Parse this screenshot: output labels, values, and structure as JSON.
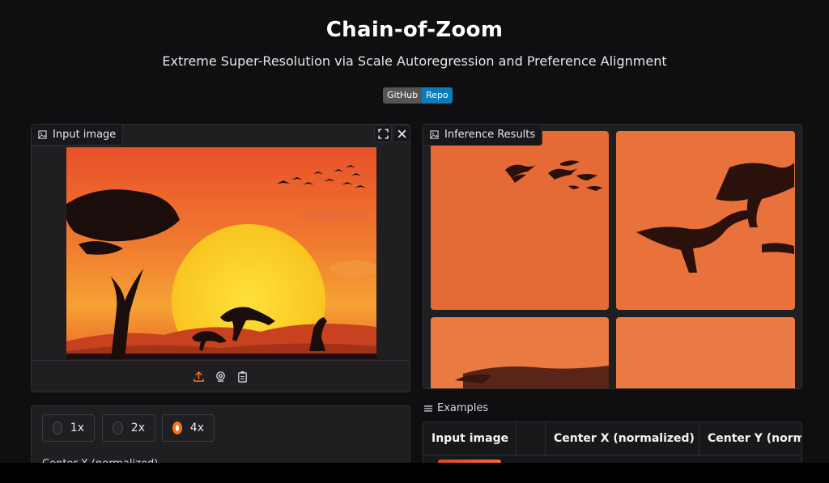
{
  "header": {
    "title": "Chain-of-Zoom",
    "subtitle": "Extreme Super-Resolution via Scale Autoregression and Preference Alignment",
    "badge_left": "GitHub",
    "badge_right": "Repo"
  },
  "input_panel": {
    "label": "Input image",
    "icons": [
      "image-icon",
      "fullscreen-icon",
      "close-icon",
      "upload-icon",
      "webcam-icon",
      "clipboard-icon"
    ]
  },
  "results_panel": {
    "label": "Inference Results"
  },
  "controls": {
    "scale_options": [
      {
        "label": "1x",
        "selected": false
      },
      {
        "label": "2x",
        "selected": false
      },
      {
        "label": "4x",
        "selected": true
      }
    ],
    "slider_label": "Center X (normalized)"
  },
  "examples": {
    "label": "Examples",
    "columns": [
      "Input image",
      "",
      "Center X (normalized)",
      "Center Y (normalized)"
    ]
  },
  "colors": {
    "accent": "#f97316",
    "badge_right": "#0a7bbb",
    "background": "#0f0f11"
  }
}
